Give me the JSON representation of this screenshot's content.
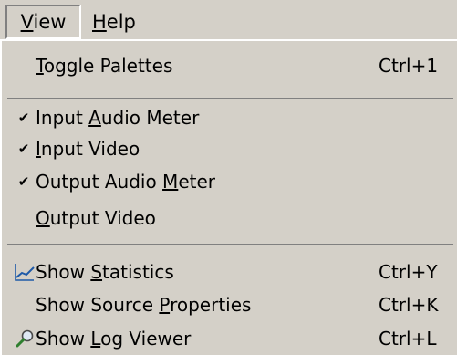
{
  "menubar": {
    "view": {
      "pre": "",
      "mn": "V",
      "post": "iew"
    },
    "help": {
      "pre": "",
      "mn": "H",
      "post": "elp"
    }
  },
  "menu": {
    "toggle_palettes": {
      "pre": "",
      "mn": "T",
      "post": "oggle Palettes",
      "shortcut": "Ctrl+1"
    },
    "input_audio_meter": {
      "pre": "Input ",
      "mn": "A",
      "post": "udio Meter",
      "checked": true
    },
    "input_video": {
      "pre": "",
      "mn": "I",
      "post": "nput Video",
      "checked": true
    },
    "output_audio_meter": {
      "pre": "Output Audio ",
      "mn": "M",
      "post": "eter",
      "checked": true
    },
    "output_video": {
      "pre": "",
      "mn": "O",
      "post": "utput Video",
      "checked": false
    },
    "show_statistics": {
      "pre": "Show ",
      "mn": "S",
      "post": "tatistics",
      "shortcut": "Ctrl+Y",
      "icon": "statistics-chart-icon"
    },
    "show_source_properties": {
      "pre": "Show Source ",
      "mn": "P",
      "post": "roperties",
      "shortcut": "Ctrl+K"
    },
    "show_log_viewer": {
      "pre": "Show ",
      "mn": "L",
      "post": "og Viewer",
      "shortcut": "Ctrl+L",
      "icon": "magnifier-icon"
    },
    "check_glyph": "✔"
  },
  "colors": {
    "menu_background": "#d4d0c8",
    "chart_line": "#1e5aa8",
    "magnifier_handle": "#2f7f2f"
  }
}
